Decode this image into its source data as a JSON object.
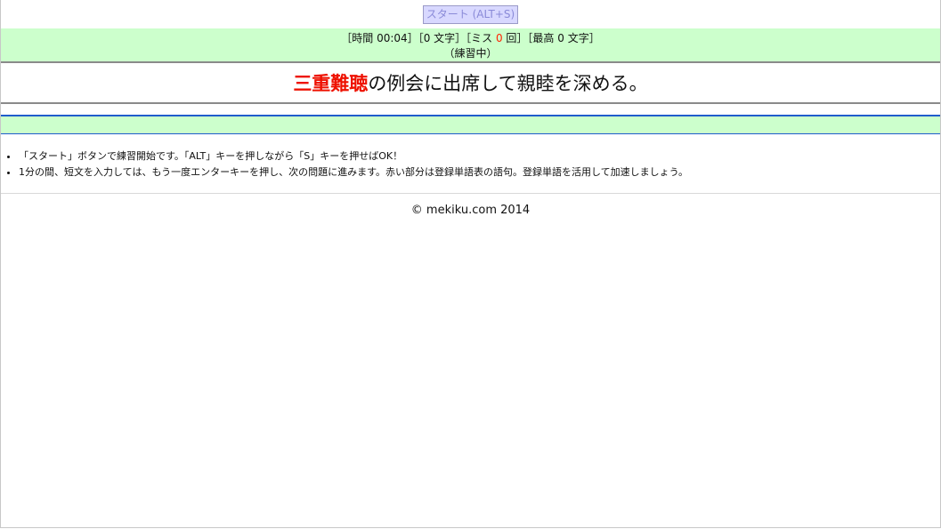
{
  "toolbar": {
    "start_label": "スタート (ALT+S)"
  },
  "status": {
    "time_prefix": "［時間 ",
    "time_value": "00:04",
    "chars_segment": "］［0 文字］［ミス ",
    "miss_value": "0",
    "miss_suffix": " 回］［最高 0 文字］",
    "mode": "（練習中）"
  },
  "sentence": {
    "highlight": "三重難聴",
    "rest": "の例会に出席して親睦を深める。"
  },
  "instructions": [
    "「スタート」ボタンで練習開始です。「ALT」キーを押しながら「S」キーを押せばOK！",
    "1分の間、短文を入力しては、もう一度エンターキーを押し、次の問題に進みます。赤い部分は登録単語表の語句。登録単語を活用して加速しましょう。"
  ],
  "footer": {
    "copyright": "© mekiku.com 2014"
  },
  "colors": {
    "panel_green": "#ccffcc",
    "highlight_red": "#ee1100",
    "divider_blue": "#1f5ccc",
    "button_bg": "#d8d8ff"
  }
}
